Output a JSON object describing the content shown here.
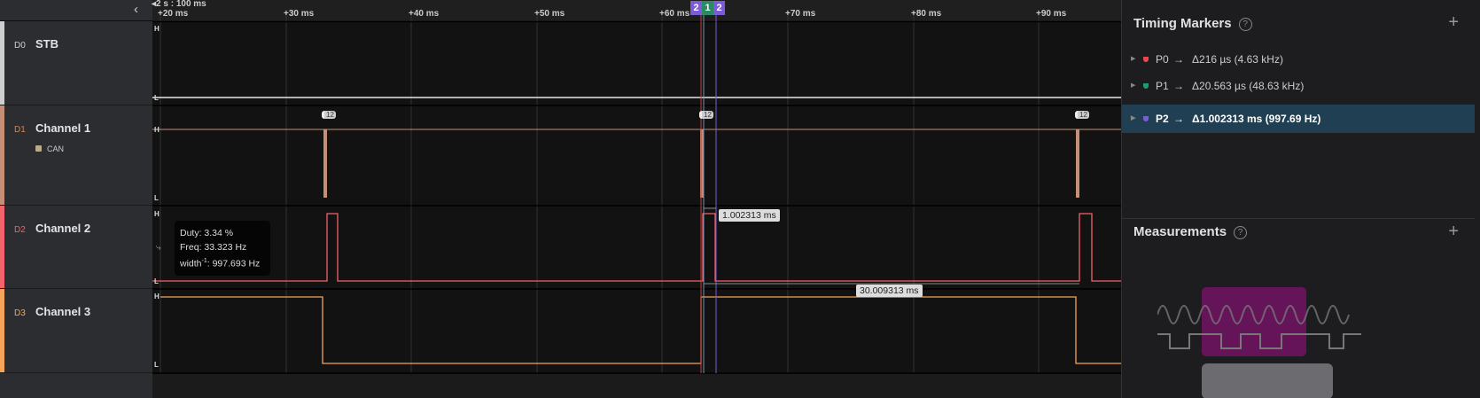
{
  "ruler": {
    "scale": "2 s : 100 ms",
    "ticks": [
      "+20 ms",
      "+30 ms",
      "+40 ms",
      "+50 ms",
      "+60 ms",
      "+70 ms",
      "+80 ms",
      "+90 ms"
    ]
  },
  "channels": [
    {
      "id": "D0",
      "name": "STB",
      "color": "#cfcfcf"
    },
    {
      "id": "D1",
      "name": "Channel 1",
      "protocol": "CAN",
      "color": "#c48e77"
    },
    {
      "id": "D2",
      "name": "Channel 2",
      "color": "#f2636d"
    },
    {
      "id": "D3",
      "name": "Channel 3",
      "color": "#f5a55a"
    }
  ],
  "level_labels": {
    "high": "H",
    "low": "L"
  },
  "can_badge": "12",
  "marker_flags": [
    "2",
    "1",
    "2"
  ],
  "tooltip": {
    "duty": "Duty: 3.34 %",
    "freq": "Freq: 33.323 Hz",
    "width_prefix": "width",
    "width_sup": "-1",
    "width_value": ": 997.693 Hz"
  },
  "measure_labels": {
    "pulse": "1.002313 ms",
    "period": "30.009313 ms"
  },
  "timing_markers": {
    "title": "Timing Markers",
    "help": "?",
    "add": "+",
    "items": [
      {
        "label": "P0",
        "arrow": "→",
        "value": "Δ216 µs (4.63 kHz)",
        "color": "#e5484d"
      },
      {
        "label": "P1",
        "arrow": "→",
        "value": "Δ20.563 µs (48.63 kHz)",
        "color": "#1f9d6b"
      },
      {
        "label": "P2",
        "arrow": "→",
        "value": "Δ1.002313 ms (997.69 Hz)",
        "color": "#7c5cd6",
        "selected": true
      }
    ]
  },
  "measurements": {
    "title": "Measurements",
    "help": "?",
    "add": "+"
  }
}
